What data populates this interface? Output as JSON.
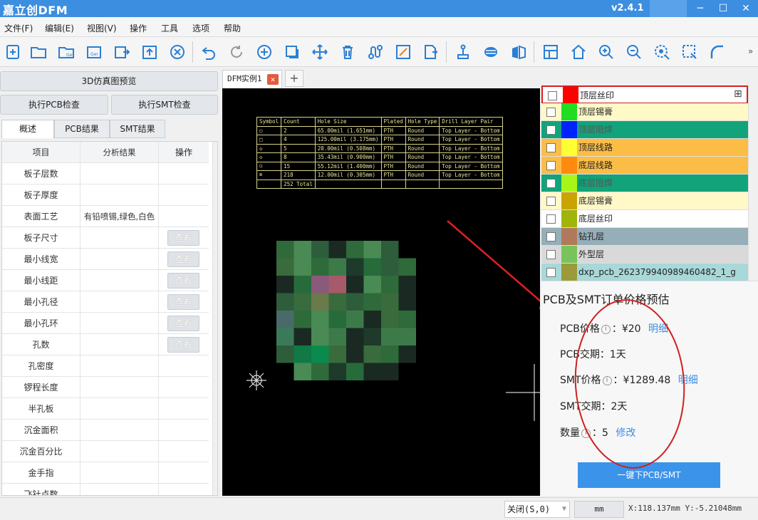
{
  "app": {
    "title": "嘉立创DFM",
    "version": "v2.4.1"
  },
  "window": {
    "minimize": "─",
    "maximize": "☐",
    "close": "✕"
  },
  "menu": [
    "文件(F)",
    "编辑(E)",
    "视图(V)",
    "操作",
    "工具",
    "选项",
    "帮助"
  ],
  "toolbar": {
    "icons": [
      "new-icon",
      "open-icon",
      "open-gerber-icon",
      "open-gerber-alt-icon",
      "export-odb-icon",
      "upload-icon",
      "close-circle-icon",
      "undo-icon",
      "redo-icon",
      "add-icon",
      "layer-box-icon",
      "move-icon",
      "delete-icon",
      "route-icon",
      "measure-box-icon",
      "export-icon",
      "probe-icon",
      "fill-icon",
      "mirror-icon",
      "window-icon",
      "home-icon",
      "zoom-in-icon",
      "zoom-out-icon",
      "zoom-fit-icon",
      "select-box-icon",
      "arc-icon"
    ],
    "more": "»"
  },
  "left": {
    "preview_button": "3D仿真图预览",
    "pcb_check_button": "执行PCB检查",
    "smt_check_button": "执行SMT检查",
    "tabs": [
      "概述",
      "PCB结果",
      "SMT结果"
    ],
    "columns": [
      "项目",
      "分析结果",
      "操作"
    ],
    "rows": [
      {
        "item": "板子层数",
        "result": "",
        "action": ""
      },
      {
        "item": "板子厚度",
        "result": "",
        "action": ""
      },
      {
        "item": "表面工艺",
        "result": "有铅喷锡,绿色,白色",
        "action": ""
      },
      {
        "item": "板子尺寸",
        "result": "",
        "action": "查看"
      },
      {
        "item": "最小线宽",
        "result": "",
        "action": "查看"
      },
      {
        "item": "最小线距",
        "result": "",
        "action": "查看"
      },
      {
        "item": "最小孔径",
        "result": "",
        "action": "查看"
      },
      {
        "item": "最小孔环",
        "result": "",
        "action": "查看"
      },
      {
        "item": "孔数",
        "result": "",
        "action": "查看"
      },
      {
        "item": "孔密度",
        "result": "",
        "action": ""
      },
      {
        "item": "锣程长度",
        "result": "",
        "action": ""
      },
      {
        "item": "半孔板",
        "result": "",
        "action": ""
      },
      {
        "item": "沉金面积",
        "result": "",
        "action": ""
      },
      {
        "item": "沉金百分比",
        "result": "",
        "action": ""
      },
      {
        "item": "金手指",
        "result": "",
        "action": ""
      },
      {
        "item": "飞针点数",
        "result": "",
        "action": ""
      }
    ]
  },
  "doc": {
    "tab_label": "DFM实例1",
    "close": "✕",
    "add": "+"
  },
  "hole_table": {
    "headers": [
      "Symbol",
      "Count",
      "Hole Size",
      "Plated",
      "Hole Type",
      "Drill Layer Pair"
    ],
    "rows": [
      [
        "○",
        "2",
        "65.00mil (1.651mm)",
        "PTH",
        "Round",
        "Top Layer - Bottom"
      ],
      [
        "□",
        "4",
        "125.00mil (3.175mm)",
        "PTH",
        "Round",
        "Top Layer - Bottom"
      ],
      [
        "◇",
        "5",
        "20.00mil (0.508mm)",
        "PTH",
        "Round",
        "Top Layer - Bottom"
      ],
      [
        "◇",
        "8",
        "35.43mil (0.900mm)",
        "PTH",
        "Round",
        "Top Layer - Bottom"
      ],
      [
        "⌑",
        "15",
        "55.12mil (1.400mm)",
        "PTH",
        "Round",
        "Top Layer - Bottom"
      ],
      [
        "⌘",
        "218",
        "12.00mil (0.305mm)",
        "PTH",
        "Round",
        "Top Layer - Bottom"
      ],
      [
        "",
        "252 Total",
        "",
        "",
        "",
        ""
      ]
    ]
  },
  "layers": [
    {
      "name": "顶层丝印",
      "color": "#ff0000",
      "bg": "#ffffff",
      "text": "#222222",
      "selected": true
    },
    {
      "name": "顶层锡膏",
      "color": "#22dd22",
      "bg": "#fff9c8",
      "text": "#222222"
    },
    {
      "name": "顶层阻焊",
      "color": "#0022ff",
      "bg": "#12a37a",
      "text": "#555555"
    },
    {
      "name": "顶层线路",
      "color": "#ffff33",
      "bg": "#fbbd46",
      "text": "#222222"
    },
    {
      "name": "底层线路",
      "color": "#ff8a10",
      "bg": "#fbbd46",
      "text": "#222222"
    },
    {
      "name": "底层阻焊",
      "color": "#a8f51a",
      "bg": "#12a37a",
      "text": "#555555"
    },
    {
      "name": "底层锡膏",
      "color": "#c9a400",
      "bg": "#fff9c8",
      "text": "#222222"
    },
    {
      "name": "底层丝印",
      "color": "#a0b40a",
      "bg": "#ffffff",
      "text": "#222222"
    },
    {
      "name": "钻孔层",
      "color": "#b07a5a",
      "bg": "#95aeb8",
      "text": "#222222"
    },
    {
      "name": "外型层",
      "color": "#78c45a",
      "bg": "#d9d9d9",
      "text": "#222222"
    },
    {
      "name": "dxp_pcb_262379940989460482_1_g",
      "color": "#9a9a3a",
      "bg": "#a8d8d8",
      "text": "#222222"
    }
  ],
  "price": {
    "title": "PCB及SMT订单价格预估",
    "pcb_price_label": "PCB价格",
    "pcb_price_value": "：¥20",
    "pcb_detail": "明细",
    "pcb_leadtime": "PCB交期：1天",
    "smt_price_label": "SMT价格",
    "smt_price_value": "：¥1289.48",
    "smt_detail": "明细",
    "smt_leadtime": "SMT交期：2天",
    "qty_label": "数量",
    "qty_value": "：5",
    "qty_modify": "修改",
    "info": "i",
    "order_button": "一键下PCB/SMT"
  },
  "status": {
    "snap": "关闭(S,0)",
    "unit": "mm",
    "coords": "X:118.137mm Y:-5.21048mm"
  }
}
